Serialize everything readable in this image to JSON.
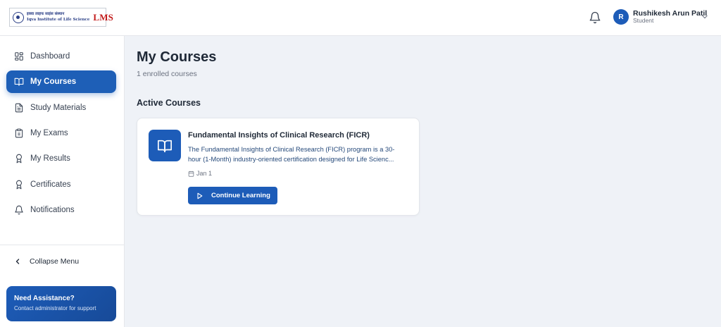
{
  "header": {
    "logo": {
      "line1": "इक्वा लाइफ साइंस संस्थान",
      "line2": "Iqva Institute of Life Science",
      "lms": "LMS"
    },
    "user": {
      "initial": "R",
      "name": "Rushikesh Arun Patil",
      "role": "Student"
    },
    "icons": [
      "bell-icon",
      "chevron-down-icon"
    ]
  },
  "sidebar": {
    "items": [
      {
        "label": "Dashboard",
        "icon": "dashboard-grid-icon",
        "active": false
      },
      {
        "label": "My Courses",
        "icon": "book-open-icon",
        "active": true
      },
      {
        "label": "Study Materials",
        "icon": "document-icon",
        "active": false
      },
      {
        "label": "My Exams",
        "icon": "clipboard-icon",
        "active": false
      },
      {
        "label": "My Results",
        "icon": "award-icon",
        "active": false
      },
      {
        "label": "Certificates",
        "icon": "certificate-icon",
        "active": false
      },
      {
        "label": "Notifications",
        "icon": "bell-icon",
        "active": false
      }
    ],
    "collapse_label": "Collapse Menu",
    "assist": {
      "title": "Need Assistance?",
      "subtitle": "Contact administrator for support"
    }
  },
  "main": {
    "title": "My Courses",
    "subtitle": "1 enrolled courses",
    "section_title": "Active Courses",
    "courses": [
      {
        "title": "Fundamental Insights of Clinical Research (FICR)",
        "description": "The Fundamental Insights of Clinical Research (FICR) program is a 30-hour (1-Month) industry-oriented certification designed for Life Scienc...",
        "date": "Jan 1",
        "button_label": "Continue Learning"
      }
    ]
  },
  "colors": {
    "primary": "#1d5cb8",
    "background": "#eff2f7",
    "brand_red": "#c21b1b"
  }
}
